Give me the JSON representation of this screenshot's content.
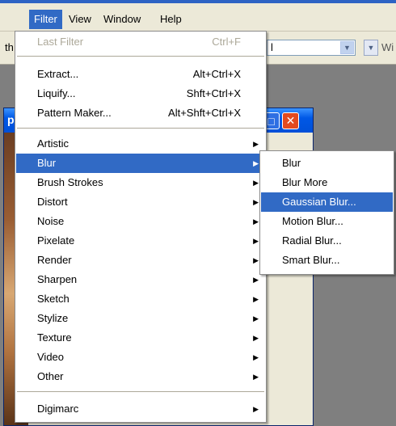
{
  "menubar": {
    "items": [
      {
        "label": "Filter"
      },
      {
        "label": "View"
      },
      {
        "label": "Window"
      },
      {
        "label": "Help"
      }
    ]
  },
  "options_bar": {
    "left_text": "th",
    "select_value": "l",
    "right_text": "Wi"
  },
  "document_window": {
    "title_fragment": "p",
    "maximize_glyph": "□",
    "close_glyph": "✕"
  },
  "filter_menu": {
    "items": [
      {
        "label": "Last Filter",
        "shortcut": "Ctrl+F",
        "disabled": true
      },
      {
        "label": "Extract...",
        "shortcut": "Alt+Ctrl+X"
      },
      {
        "label": "Liquify...",
        "shortcut": "Shft+Ctrl+X"
      },
      {
        "label": "Pattern Maker...",
        "shortcut": "Alt+Shft+Ctrl+X"
      },
      {
        "label": "Artistic",
        "submenu": true
      },
      {
        "label": "Blur",
        "submenu": true,
        "highlighted": true
      },
      {
        "label": "Brush Strokes",
        "submenu": true
      },
      {
        "label": "Distort",
        "submenu": true
      },
      {
        "label": "Noise",
        "submenu": true
      },
      {
        "label": "Pixelate",
        "submenu": true
      },
      {
        "label": "Render",
        "submenu": true
      },
      {
        "label": "Sharpen",
        "submenu": true
      },
      {
        "label": "Sketch",
        "submenu": true
      },
      {
        "label": "Stylize",
        "submenu": true
      },
      {
        "label": "Texture",
        "submenu": true
      },
      {
        "label": "Video",
        "submenu": true
      },
      {
        "label": "Other",
        "submenu": true
      },
      {
        "label": "Digimarc",
        "submenu": true
      }
    ],
    "arrow_glyph": "▶"
  },
  "blur_submenu": {
    "items": [
      {
        "label": "Blur"
      },
      {
        "label": "Blur More"
      },
      {
        "label": "Gaussian Blur...",
        "highlighted": true
      },
      {
        "label": "Motion Blur..."
      },
      {
        "label": "Radial Blur..."
      },
      {
        "label": "Smart Blur..."
      }
    ]
  },
  "colors": {
    "highlight": "#316ac5",
    "menu_bg": "#ffffff",
    "chrome": "#ece9d8",
    "disabled_text": "#aca899"
  }
}
